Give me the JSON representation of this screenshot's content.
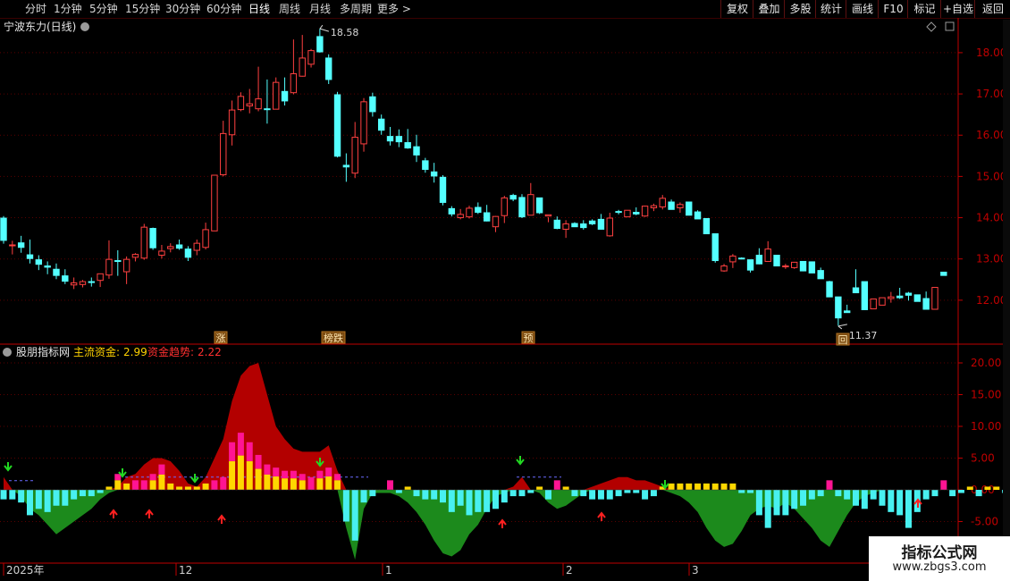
{
  "toolbar": {
    "items": [
      "分时",
      "1分钟",
      "5分钟",
      "15分钟",
      "30分钟",
      "60分钟",
      "日线",
      "周线",
      "月线",
      "多周期",
      "更多 >"
    ],
    "active": "日线",
    "right_items": [
      "复权",
      "叠加",
      "多股",
      "统计",
      "画线",
      "F10",
      "标记",
      "+自选",
      "返回"
    ]
  },
  "price_panel": {
    "title": "宁波东力(日线)",
    "high_label": "18.58",
    "low_label": "11.37",
    "markers": [
      "涨",
      "榜跌",
      "预",
      "回"
    ]
  },
  "indicator_panel": {
    "title": "股朋指标网",
    "label1": "主流资金:",
    "value1": "2.99",
    "label2": "资金趋势:",
    "value2": "2.22"
  },
  "time_axis": {
    "labels": [
      "2025年",
      "12",
      "1",
      "2",
      "3"
    ]
  },
  "watermark": {
    "title": "指标公式网",
    "url": "www.zbgs3.com"
  },
  "colors": {
    "up": "#ff4040",
    "down": "#54ffff",
    "axis": "#c00000",
    "trend_pos": "#b30000",
    "trend_neg": "#1c8a1c",
    "bar_yellow": "#ffd700",
    "bar_pink": "#ff1493",
    "bar_cyan": "#48f0f0",
    "label_yellow": "#ffd200",
    "label_red": "#ff3030"
  },
  "chart_data": [
    {
      "type": "candlestick",
      "title": "宁波东力(日线)",
      "ylim": [
        11.0,
        18.8
      ],
      "y_ticks": [
        12.0,
        13.0,
        14.0,
        15.0,
        16.0,
        17.0,
        18.0
      ],
      "candles": [
        [
          13.99,
          14.04,
          13.37,
          13.45
        ],
        [
          13.33,
          13.44,
          13.11,
          13.34
        ],
        [
          13.39,
          13.56,
          13.15,
          13.28
        ],
        [
          13.1,
          13.47,
          12.89,
          13.01
        ],
        [
          12.98,
          13.09,
          12.73,
          12.87
        ],
        [
          12.83,
          12.94,
          12.63,
          12.8
        ],
        [
          12.75,
          12.89,
          12.51,
          12.6
        ],
        [
          12.59,
          12.75,
          12.39,
          12.46
        ],
        [
          12.37,
          12.55,
          12.27,
          12.42
        ],
        [
          12.38,
          12.49,
          12.31,
          12.45
        ],
        [
          12.45,
          12.55,
          12.33,
          12.43
        ],
        [
          12.48,
          12.63,
          12.32,
          12.64
        ],
        [
          12.61,
          13.45,
          12.52,
          12.99
        ],
        [
          12.96,
          13.21,
          12.59,
          12.94
        ],
        [
          12.69,
          13.06,
          12.39,
          12.99
        ],
        [
          13.04,
          13.14,
          12.94,
          13.11
        ],
        [
          13.02,
          13.85,
          12.98,
          13.77
        ],
        [
          13.74,
          13.76,
          13.22,
          13.27
        ],
        [
          13.09,
          13.34,
          13.01,
          13.19
        ],
        [
          13.25,
          13.38,
          13.16,
          13.3
        ],
        [
          13.34,
          13.47,
          13.22,
          13.26
        ],
        [
          13.24,
          13.31,
          12.95,
          13.04
        ],
        [
          13.21,
          13.47,
          13.09,
          13.38
        ],
        [
          13.28,
          13.88,
          13.23,
          13.71
        ],
        [
          13.68,
          15.03,
          13.68,
          15.03
        ],
        [
          15.04,
          16.35,
          15.0,
          16.04
        ],
        [
          16.01,
          16.84,
          15.75,
          16.61
        ],
        [
          16.62,
          17.04,
          16.58,
          16.94
        ],
        [
          16.71,
          17.12,
          16.53,
          16.76
        ],
        [
          16.64,
          17.66,
          16.58,
          16.88
        ],
        [
          16.64,
          17.35,
          16.28,
          16.63
        ],
        [
          16.63,
          17.4,
          16.63,
          17.28
        ],
        [
          17.06,
          17.4,
          16.72,
          16.83
        ],
        [
          17.03,
          18.32,
          16.99,
          17.49
        ],
        [
          17.43,
          18.43,
          17.42,
          17.87
        ],
        [
          17.72,
          18.09,
          17.64,
          18.05
        ],
        [
          18.39,
          18.58,
          18.0,
          18.02
        ],
        [
          17.87,
          17.96,
          17.24,
          17.35
        ],
        [
          16.98,
          17.05,
          15.46,
          15.49
        ],
        [
          15.27,
          15.56,
          14.87,
          15.23
        ],
        [
          15.08,
          16.32,
          14.96,
          15.95
        ],
        [
          15.79,
          16.9,
          15.6,
          16.81
        ],
        [
          16.93,
          17.03,
          16.45,
          16.57
        ],
        [
          16.39,
          16.5,
          16.01,
          16.12
        ],
        [
          15.97,
          16.2,
          15.75,
          15.86
        ],
        [
          15.97,
          16.14,
          15.71,
          15.84
        ],
        [
          15.82,
          16.15,
          15.67,
          15.69
        ],
        [
          15.72,
          16.01,
          15.35,
          15.52
        ],
        [
          15.38,
          15.45,
          15.09,
          15.17
        ],
        [
          15.11,
          15.33,
          14.85,
          15.01
        ],
        [
          14.98,
          15.03,
          14.3,
          14.37
        ],
        [
          14.22,
          14.28,
          14.03,
          14.09
        ],
        [
          14.0,
          14.21,
          13.96,
          14.08
        ],
        [
          14.02,
          14.29,
          13.98,
          14.23
        ],
        [
          14.25,
          14.37,
          14.09,
          14.13
        ],
        [
          14.12,
          14.31,
          13.91,
          13.92
        ],
        [
          13.78,
          14.04,
          13.65,
          14.03
        ],
        [
          14.05,
          14.53,
          13.87,
          14.48
        ],
        [
          14.54,
          14.58,
          14.4,
          14.45
        ],
        [
          14.49,
          14.57,
          13.99,
          14.02
        ],
        [
          14.06,
          14.84,
          14.07,
          14.56
        ],
        [
          14.48,
          14.48,
          14.09,
          14.12
        ],
        [
          14.04,
          14.01,
          13.89,
          14.07
        ],
        [
          13.94,
          14.03,
          13.72,
          13.74
        ],
        [
          13.72,
          13.94,
          13.51,
          13.85
        ],
        [
          13.86,
          13.89,
          13.78,
          13.78
        ],
        [
          13.85,
          13.94,
          13.71,
          13.76
        ],
        [
          13.92,
          13.96,
          13.82,
          13.85
        ],
        [
          13.96,
          14.09,
          13.71,
          13.72
        ],
        [
          13.56,
          14.12,
          13.54,
          13.99
        ],
        [
          14.15,
          14.19,
          14.08,
          14.14
        ],
        [
          14.02,
          14.16,
          14.04,
          14.18
        ],
        [
          14.13,
          14.25,
          14.06,
          14.09
        ],
        [
          14.04,
          14.29,
          14.02,
          14.28
        ],
        [
          14.24,
          14.34,
          14.16,
          14.29
        ],
        [
          14.26,
          14.55,
          14.2,
          14.47
        ],
        [
          14.38,
          14.44,
          14.24,
          14.2
        ],
        [
          14.24,
          14.37,
          14.12,
          14.32
        ],
        [
          14.38,
          14.37,
          14.19,
          14.06
        ],
        [
          14.14,
          14.18,
          13.97,
          13.97
        ],
        [
          13.98,
          13.91,
          13.88,
          13.61
        ],
        [
          13.61,
          13.52,
          12.91,
          12.96
        ],
        [
          12.71,
          12.88,
          12.69,
          12.83
        ],
        [
          12.93,
          13.12,
          12.78,
          13.07
        ],
        [
          13.02,
          13.04,
          12.99,
          13.01
        ],
        [
          12.98,
          12.98,
          12.67,
          12.73
        ],
        [
          13.09,
          13.26,
          12.87,
          12.88
        ],
        [
          12.94,
          13.43,
          12.99,
          13.24
        ],
        [
          13.09,
          13.05,
          12.84,
          12.83
        ],
        [
          12.82,
          12.88,
          12.76,
          12.83
        ],
        [
          12.79,
          12.92,
          12.76,
          12.92
        ],
        [
          12.94,
          12.91,
          12.7,
          12.71
        ],
        [
          12.93,
          12.94,
          12.85,
          12.66
        ],
        [
          12.72,
          12.79,
          12.65,
          12.52
        ],
        [
          12.45,
          12.47,
          12.13,
          12.08
        ],
        [
          12.08,
          11.77,
          11.38,
          11.57
        ],
        [
          11.74,
          11.89,
          11.72,
          11.7
        ],
        [
          12.3,
          12.75,
          12.25,
          12.18
        ],
        [
          12.45,
          12.15,
          12.05,
          11.77
        ],
        [
          11.79,
          12.01,
          11.82,
          12.03
        ],
        [
          11.88,
          12.05,
          11.9,
          12.06
        ],
        [
          12.04,
          12.2,
          11.94,
          12.08
        ],
        [
          12.1,
          12.3,
          12.03,
          12.06
        ],
        [
          12.17,
          12.2,
          11.99,
          12.12
        ],
        [
          12.13,
          12.13,
          12.06,
          11.97
        ],
        [
          12.04,
          12.21,
          11.8,
          11.78
        ],
        [
          11.78,
          12.28,
          12.1,
          12.31
        ],
        [
          12.68,
          12.68,
          12.62,
          12.6
        ]
      ],
      "high_point": 18.58,
      "low_point": 11.37
    },
    {
      "type": "bar",
      "title": "股朋指标网",
      "ylim": [
        -10.0,
        22.0
      ],
      "y_ticks": [
        -5.0,
        0.0,
        5.0,
        10.0,
        15.0,
        20.0
      ],
      "series": [
        {
          "name": "主流资金",
          "values": [
            -1.5,
            -1.5,
            -2.0,
            -4.0,
            -3.0,
            -3.5,
            -2.5,
            -2.5,
            -1.5,
            -1.0,
            -1.0,
            -0.5,
            0.5,
            2.5,
            1.0,
            1.5,
            1.5,
            2.5,
            4.0,
            1.0,
            0.5,
            0.5,
            0.5,
            1.0,
            1.5,
            2.0,
            7.5,
            9.0,
            7.5,
            5.5,
            4.0,
            3.5,
            3.0,
            3.0,
            2.5,
            2.0,
            3.0,
            3.5,
            2.5,
            -5.0,
            -8.0,
            -2.0,
            -1.0,
            0,
            1.5,
            -0.5,
            0.5,
            -1.0,
            -1.5,
            -1.5,
            -2.0,
            -3.5,
            -2.5,
            -4.0,
            -3.5,
            -3.5,
            -3.0,
            -2.0,
            -1.0,
            -1.0,
            -0.5,
            0.5,
            -1.5,
            1.5,
            0.5,
            -1.0,
            -1.0,
            -1.5,
            -1.5,
            -1.5,
            -1.0,
            -0.5,
            -0.5,
            -1.5,
            -1.0,
            0.5,
            1.0,
            1.0,
            1.0,
            1.0,
            1.0,
            1.0,
            1.0,
            1.0,
            -0.5,
            -0.5,
            -4.0,
            -6.0,
            -4.0,
            -4.0,
            -3.0,
            -2.5,
            -1.5,
            -1.0,
            1.5,
            -1.0,
            -1.5,
            -2.5,
            -3.0,
            -1.5,
            -2.5,
            -3.5,
            -4.0,
            -6.0,
            -3.5,
            -1.5,
            -1.0,
            1.5,
            -1.0,
            -0.5,
            0.5,
            -1.0,
            0.5,
            0.5,
            -0.5,
            -1.5,
            2.0,
            3.0
          ]
        },
        {
          "name": "资金趋势",
          "values": [
            2.0,
            0,
            -1.0,
            -3.0,
            -4.0,
            -5.5,
            -7.0,
            -6.0,
            -5.0,
            -4.0,
            -3.0,
            -1.5,
            -0.5,
            0.5,
            2.0,
            2.5,
            4.0,
            5.0,
            5.0,
            4.5,
            3.0,
            1.0,
            0.5,
            2.0,
            5.0,
            8.0,
            14.0,
            18.0,
            19.5,
            20.0,
            15.0,
            10.0,
            8.0,
            6.5,
            6.0,
            6.0,
            6.0,
            7.0,
            3.0,
            -6.0,
            -11.0,
            -3.0,
            -0.5,
            -0.5,
            -0.5,
            -1.0,
            -2.0,
            -3.5,
            -5.5,
            -8.0,
            -10.0,
            -10.5,
            -9.5,
            -7.0,
            -5.5,
            -3.0,
            -1.0,
            -0.5,
            0.5,
            2.0,
            0,
            -0.5,
            -2.0,
            -3.0,
            -2.5,
            -1.5,
            -0.5,
            0.5,
            1.0,
            1.5,
            2.0,
            2.0,
            1.5,
            1.5,
            1.0,
            0.5,
            -0.5,
            -1.0,
            -2.0,
            -3.5,
            -6.0,
            -8.0,
            -9.0,
            -8.5,
            -6.5,
            -4.0,
            -3.0,
            -2.5,
            -3.0,
            -2.0,
            -3.0,
            -4.5,
            -6.0,
            -8.0,
            -9.0,
            -6.5,
            -4.0,
            -2.0,
            -1.0,
            -0.5,
            0,
            0,
            0
          ]
        }
      ],
      "baseline": 2.0
    }
  ]
}
